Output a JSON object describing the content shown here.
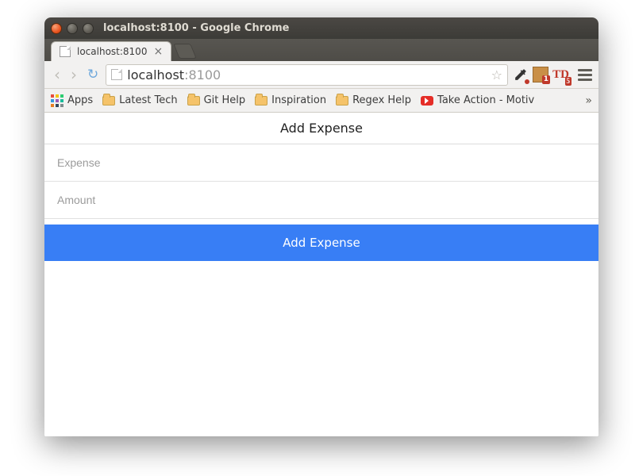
{
  "window": {
    "title": "localhost:8100 - Google Chrome"
  },
  "tab": {
    "title": "localhost:8100"
  },
  "omnibox": {
    "host": "localhost",
    "rest": ":8100"
  },
  "bookmarks": {
    "apps": "Apps",
    "items": [
      "Latest Tech",
      "Git Help",
      "Inspiration",
      "Regex Help",
      "Take Action - Motiv"
    ],
    "overflow": "»"
  },
  "extensions": {
    "box_badge": "1",
    "todo_label": "TD",
    "todo_badge": "5"
  },
  "app": {
    "header": "Add Expense",
    "expense_placeholder": "Expense",
    "amount_placeholder": "Amount",
    "button": "Add Expense"
  }
}
